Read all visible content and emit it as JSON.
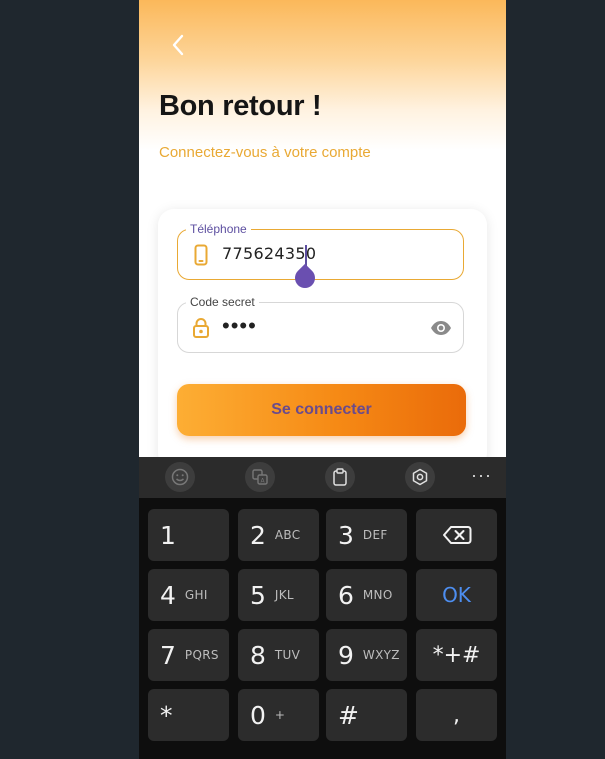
{
  "header": {
    "back_icon": "chevron-left-icon",
    "title": "Bon retour !",
    "subtitle": "Connectez-vous à votre compte"
  },
  "form": {
    "phone": {
      "label": "Téléphone",
      "value": "775624350",
      "icon": "smartphone-icon"
    },
    "code": {
      "label": "Code secret",
      "value": "••••",
      "icon": "lock-icon",
      "toggle_icon": "eye-icon"
    },
    "submit_label": "Se connecter"
  },
  "keyboard_toolbar": {
    "icons": [
      "emoji-icon",
      "translate-icon",
      "clipboard-icon",
      "settings-icon",
      "more-icon"
    ],
    "more_label": "···"
  },
  "keyboard": {
    "keys": [
      {
        "num": "1",
        "letters": ""
      },
      {
        "num": "2",
        "letters": "ABC"
      },
      {
        "num": "3",
        "letters": "DEF"
      },
      {
        "num": "4",
        "letters": "GHI"
      },
      {
        "num": "5",
        "letters": "JKL"
      },
      {
        "num": "6",
        "letters": "MNO"
      },
      {
        "num": "7",
        "letters": "PQRS"
      },
      {
        "num": "8",
        "letters": "TUV"
      },
      {
        "num": "9",
        "letters": "WXYZ"
      },
      {
        "num": "0",
        "letters": "+"
      }
    ],
    "ok_label": "OK",
    "symbols_label": "*+#",
    "star_label": "*",
    "hash_label": "#",
    "comma_label": ","
  },
  "colors": {
    "accent": "#e9a934",
    "button_gradient_start": "#fdae34",
    "button_gradient_end": "#ea6b0a",
    "button_text": "#6a4b8c",
    "cursor": "#5d4fa0",
    "ok_key": "#4d8ef0"
  }
}
